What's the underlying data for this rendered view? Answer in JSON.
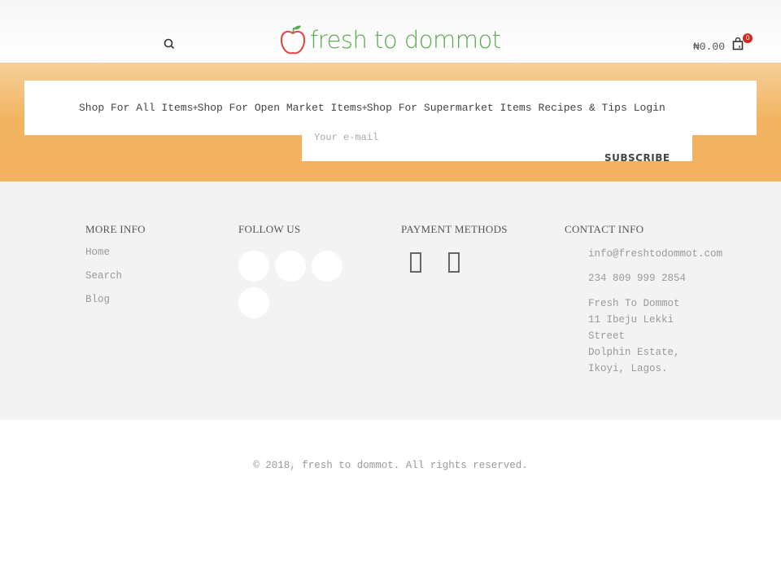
{
  "header": {
    "logo_text": "fresh to dommot",
    "cart_total": "₦0.00",
    "cart_count": "0",
    "icons": [
      "search-icon",
      "apple-logo",
      "shopping-bag-icon"
    ]
  },
  "nav": {
    "items": [
      "Shop For All Items",
      "Shop For Open Market Items",
      "Shop For Supermarket Items",
      "Recipes & Tips",
      "Login"
    ]
  },
  "newsletter": {
    "placeholder": "Your e-mail",
    "button": "SUBSCRIBE"
  },
  "footer": {
    "more_info": {
      "title": "MORE INFO",
      "links": [
        "Home",
        "Search",
        "Blog"
      ]
    },
    "follow_us": {
      "title": "FOLLOW US"
    },
    "payment": {
      "title": "PAYMENT METHODS"
    },
    "contact": {
      "title": "CONTACT INFO",
      "email": "info@freshtodommot.com",
      "phone": "234 809 999 2854",
      "address": [
        "Fresh To Dommot",
        "11 Ibeju Lekki",
        "Street",
        "Dolphin Estate,",
        "Ikoyi, Lagos."
      ]
    }
  },
  "copyright": "© 2018, fresh to dommot. All rights reserved.",
  "colors": {
    "brand_green": "#5aab4e",
    "apple_red": "#e0454a",
    "band_orange": "#f2b25f",
    "badge_red": "#d9261c"
  }
}
